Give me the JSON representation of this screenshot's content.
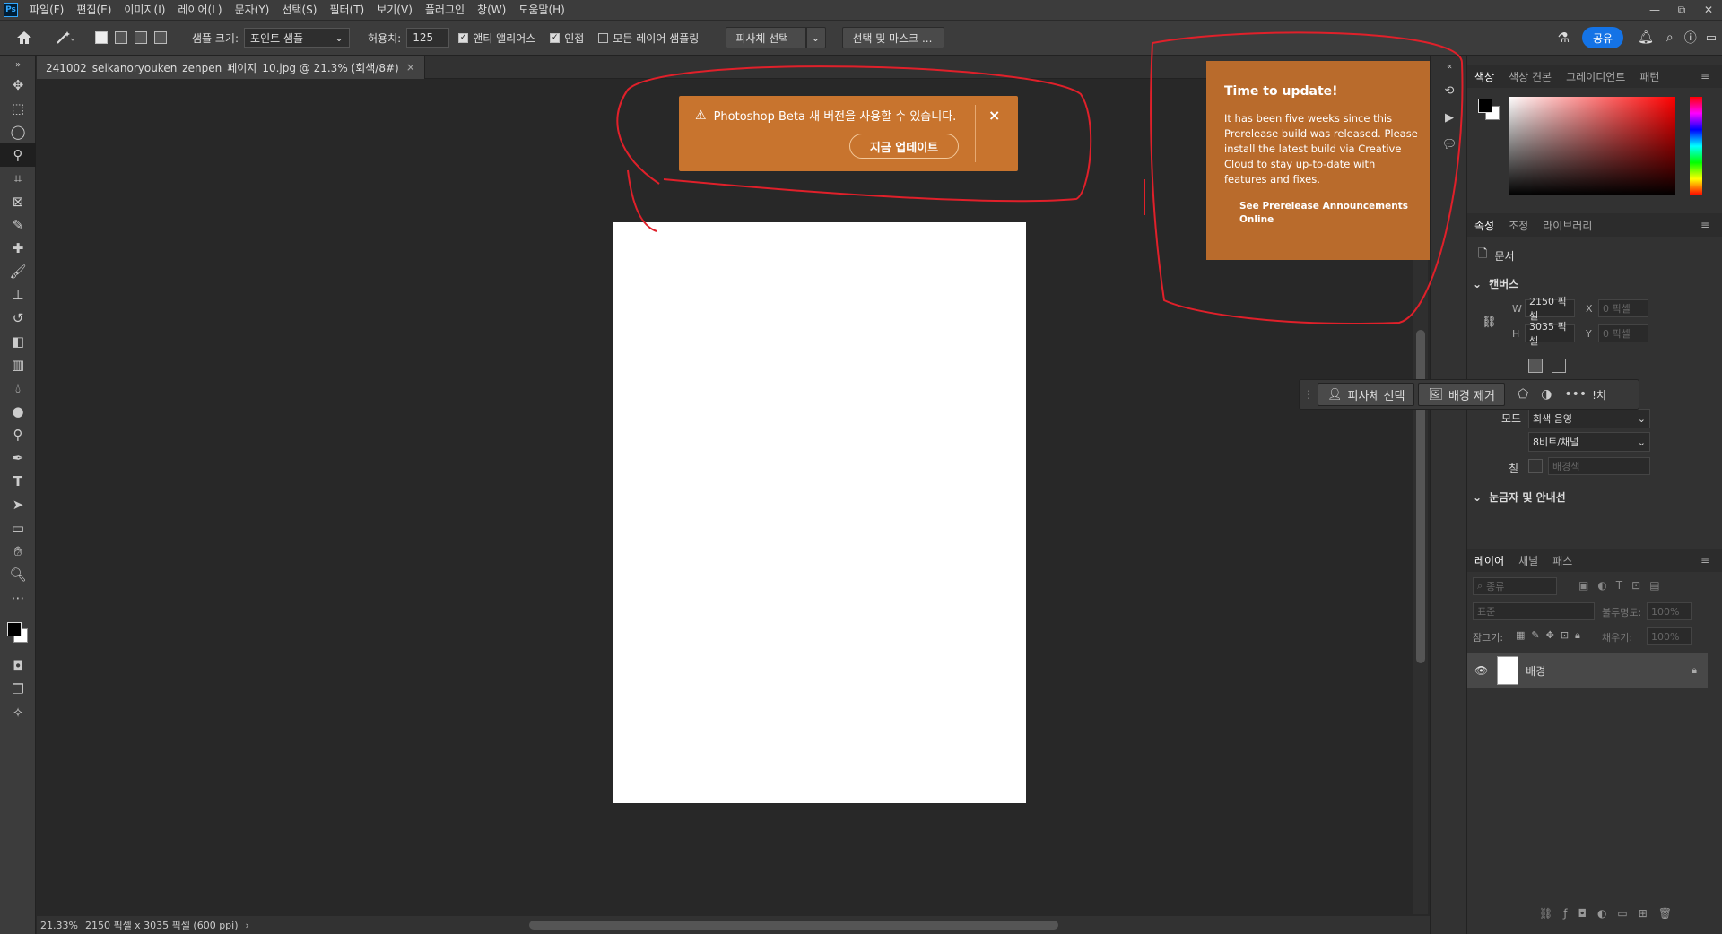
{
  "menubar": {
    "app_icon": "Ps",
    "items": [
      "파일(F)",
      "편집(E)",
      "이미지(I)",
      "레이어(L)",
      "문자(Y)",
      "선택(S)",
      "필터(T)",
      "보기(V)",
      "플러그인",
      "창(W)",
      "도움말(H)"
    ],
    "window_controls": [
      "—",
      "⧉",
      "✕"
    ]
  },
  "options": {
    "sample_size_label": "샘플 크기:",
    "sample_size_value": "포인트 샘플",
    "tolerance_label": "허용치:",
    "tolerance_value": "125",
    "antialias_label": "앤티 앨리어스",
    "contiguous_label": "인접",
    "all_layers_label": "모든 레이어 샘플링",
    "select_subject_label": "피사체 선택",
    "select_mask_label": "선택 및 마스크 ...",
    "share_label": "공유"
  },
  "document": {
    "tab_title": "241002_seikanoryouken_zenpen_페이지_10.jpg @ 21.3% (회색/8#)",
    "tab_close": "×",
    "zoom": "21.33%",
    "info": "2150 픽셀 x 3035 픽셀 (600 ppi)",
    "info_arrow": "›"
  },
  "notification": {
    "message": "Photoshop Beta 새 버전을 사용할 수 있습니다.",
    "update_button": "지금 업데이트",
    "close": "×",
    "warning_icon": "⚠"
  },
  "update_popup": {
    "title": "Time to update!",
    "body": "It has been five weeks since this Prerelease build was released. Please install the latest build via Creative Cloud to stay up-to-date with features and fixes.",
    "link": "See Prerelease Announcements Online"
  },
  "contextbar": {
    "select_subject": "피사체 선택",
    "remove_bg": "배경 제거",
    "more": "•••",
    "trailing": "!치"
  },
  "panels": {
    "color_tabs": [
      "색상",
      "색상 견본",
      "그레이디언트",
      "패턴"
    ],
    "props_tabs": [
      "속성",
      "조정",
      "라이브러리"
    ],
    "doc_label": "문서",
    "canvas_section": "캔버스",
    "w_label": "W",
    "w_value": "2150 픽셀",
    "h_label": "H",
    "h_value": "3035 픽셀",
    "x_label": "X",
    "x_value": "0 픽셀",
    "y_label": "Y",
    "y_value": "0 픽셀",
    "mode_label": "모드",
    "mode_value": "회색 음영",
    "bits_value": "8비트/채널",
    "fill_label": "칠",
    "fill_value": "배경색",
    "rulers_section": "눈금자 및 안내선",
    "layers_tabs": [
      "레이어",
      "채널",
      "패스"
    ],
    "filter_value": "종류",
    "blend_value": "표준",
    "opacity_label": "불투명도:",
    "opacity_value": "100%",
    "lock_label": "잠그기:",
    "fill2_label": "채우기:",
    "fill2_value": "100%",
    "layer_name": "배경"
  },
  "colors": {
    "notification_bg": "#c8742e",
    "popup_bg": "#b96b2c",
    "share_blue": "#1473e6",
    "annotation_red": "#e0202a"
  }
}
